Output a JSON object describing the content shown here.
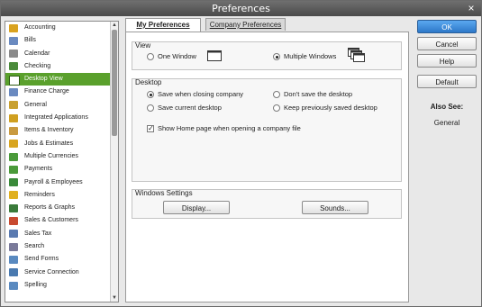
{
  "window": {
    "title": "Preferences",
    "close_glyph": "×"
  },
  "sidebar": {
    "items": [
      {
        "label": "Accounting",
        "icon": "accounting-icon",
        "color": "#d9a21f"
      },
      {
        "label": "Bills",
        "icon": "bills-icon",
        "color": "#6a8ac0"
      },
      {
        "label": "Calendar",
        "icon": "calendar-icon",
        "color": "#8a8a8a"
      },
      {
        "label": "Checking",
        "icon": "checking-icon",
        "color": "#4a8a3a"
      },
      {
        "label": "Desktop View",
        "icon": "desktop-view-icon",
        "color": "#ffffff",
        "selected": true
      },
      {
        "label": "Finance Charge",
        "icon": "finance-charge-icon",
        "color": "#6a8ac0"
      },
      {
        "label": "General",
        "icon": "general-icon",
        "color": "#c8a030"
      },
      {
        "label": "Integrated Applications",
        "icon": "integrated-apps-icon",
        "color": "#d0a020"
      },
      {
        "label": "Items & Inventory",
        "icon": "items-inventory-icon",
        "color": "#c99a40"
      },
      {
        "label": "Jobs & Estimates",
        "icon": "jobs-estimates-icon",
        "color": "#d8a520"
      },
      {
        "label": "Multiple Currencies",
        "icon": "currencies-icon",
        "color": "#4a9a3a"
      },
      {
        "label": "Payments",
        "icon": "payments-icon",
        "color": "#4a9a3a"
      },
      {
        "label": "Payroll & Employees",
        "icon": "payroll-icon",
        "color": "#3a8a3a"
      },
      {
        "label": "Reminders",
        "icon": "reminders-icon",
        "color": "#e0b020"
      },
      {
        "label": "Reports & Graphs",
        "icon": "reports-graphs-icon",
        "color": "#3a7a3a"
      },
      {
        "label": "Sales & Customers",
        "icon": "sales-customers-icon",
        "color": "#c84a30"
      },
      {
        "label": "Sales Tax",
        "icon": "sales-tax-icon",
        "color": "#5a7ab0"
      },
      {
        "label": "Search",
        "icon": "search-icon",
        "color": "#7a7a9a"
      },
      {
        "label": "Send Forms",
        "icon": "send-forms-icon",
        "color": "#5a8ac0"
      },
      {
        "label": "Service Connection",
        "icon": "service-connection-icon",
        "color": "#4a7ab0"
      },
      {
        "label": "Spelling",
        "icon": "spelling-icon",
        "color": "#5a8ac0"
      }
    ]
  },
  "tabs": {
    "my": "My Preferences",
    "company": "Company Preferences"
  },
  "view": {
    "label": "View",
    "one_window": "One Window",
    "multiple_windows": "Multiple Windows",
    "selected": "multiple"
  },
  "desktop": {
    "label": "Desktop",
    "save_when_closing": "Save when closing company",
    "dont_save": "Don't save the desktop",
    "save_current": "Save current desktop",
    "keep_previous": "Keep previously saved desktop",
    "selected": "save_when_closing",
    "show_home_page": "Show Home page when opening a company file",
    "show_home_checked": true
  },
  "windows_settings": {
    "label": "Windows Settings",
    "display": "Display...",
    "sounds": "Sounds..."
  },
  "buttons": {
    "ok": "OK",
    "cancel": "Cancel",
    "help": "Help",
    "default": "Default"
  },
  "also_see": {
    "heading": "Also See:",
    "items": [
      "General"
    ]
  }
}
